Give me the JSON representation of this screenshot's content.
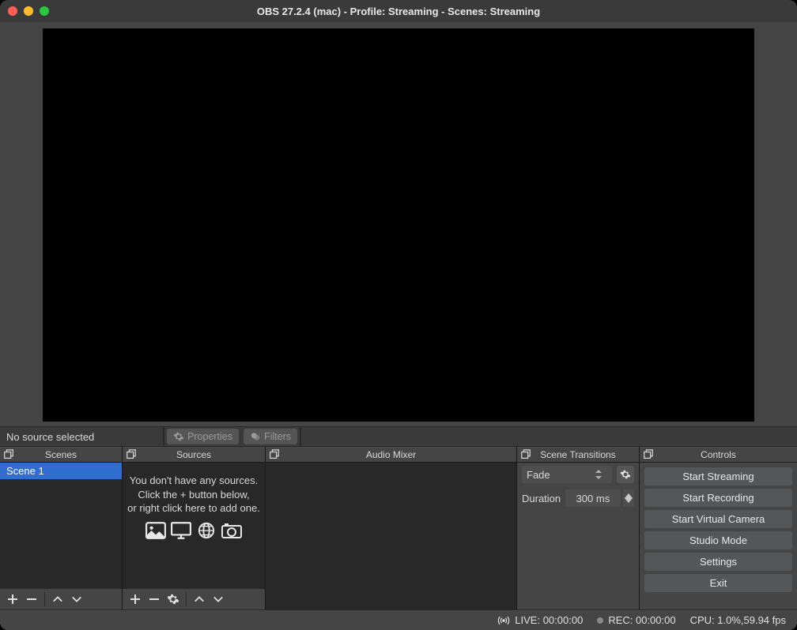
{
  "window": {
    "title": "OBS 27.2.4 (mac) - Profile: Streaming - Scenes: Streaming"
  },
  "sourcebar": {
    "noSource": "No source selected",
    "properties": "Properties",
    "filters": "Filters"
  },
  "docks": {
    "scenes": {
      "title": "Scenes",
      "items": [
        "Scene 1"
      ]
    },
    "sources": {
      "title": "Sources",
      "emptyLine1": "You don't have any sources.",
      "emptyLine2": "Click the + button below,",
      "emptyLine3": "or right click here to add one."
    },
    "audio": {
      "title": "Audio Mixer"
    },
    "transitions": {
      "title": "Scene Transitions",
      "selected": "Fade",
      "durationLabel": "Duration",
      "durationValue": "300 ms"
    },
    "controls": {
      "title": "Controls",
      "buttons": {
        "startStreaming": "Start Streaming",
        "startRecording": "Start Recording",
        "startVirtualCam": "Start Virtual Camera",
        "studioMode": "Studio Mode",
        "settings": "Settings",
        "exit": "Exit"
      }
    }
  },
  "status": {
    "live": "LIVE: 00:00:00",
    "rec": "REC: 00:00:00",
    "cpu": "CPU: 1.0%,59.94 fps"
  }
}
